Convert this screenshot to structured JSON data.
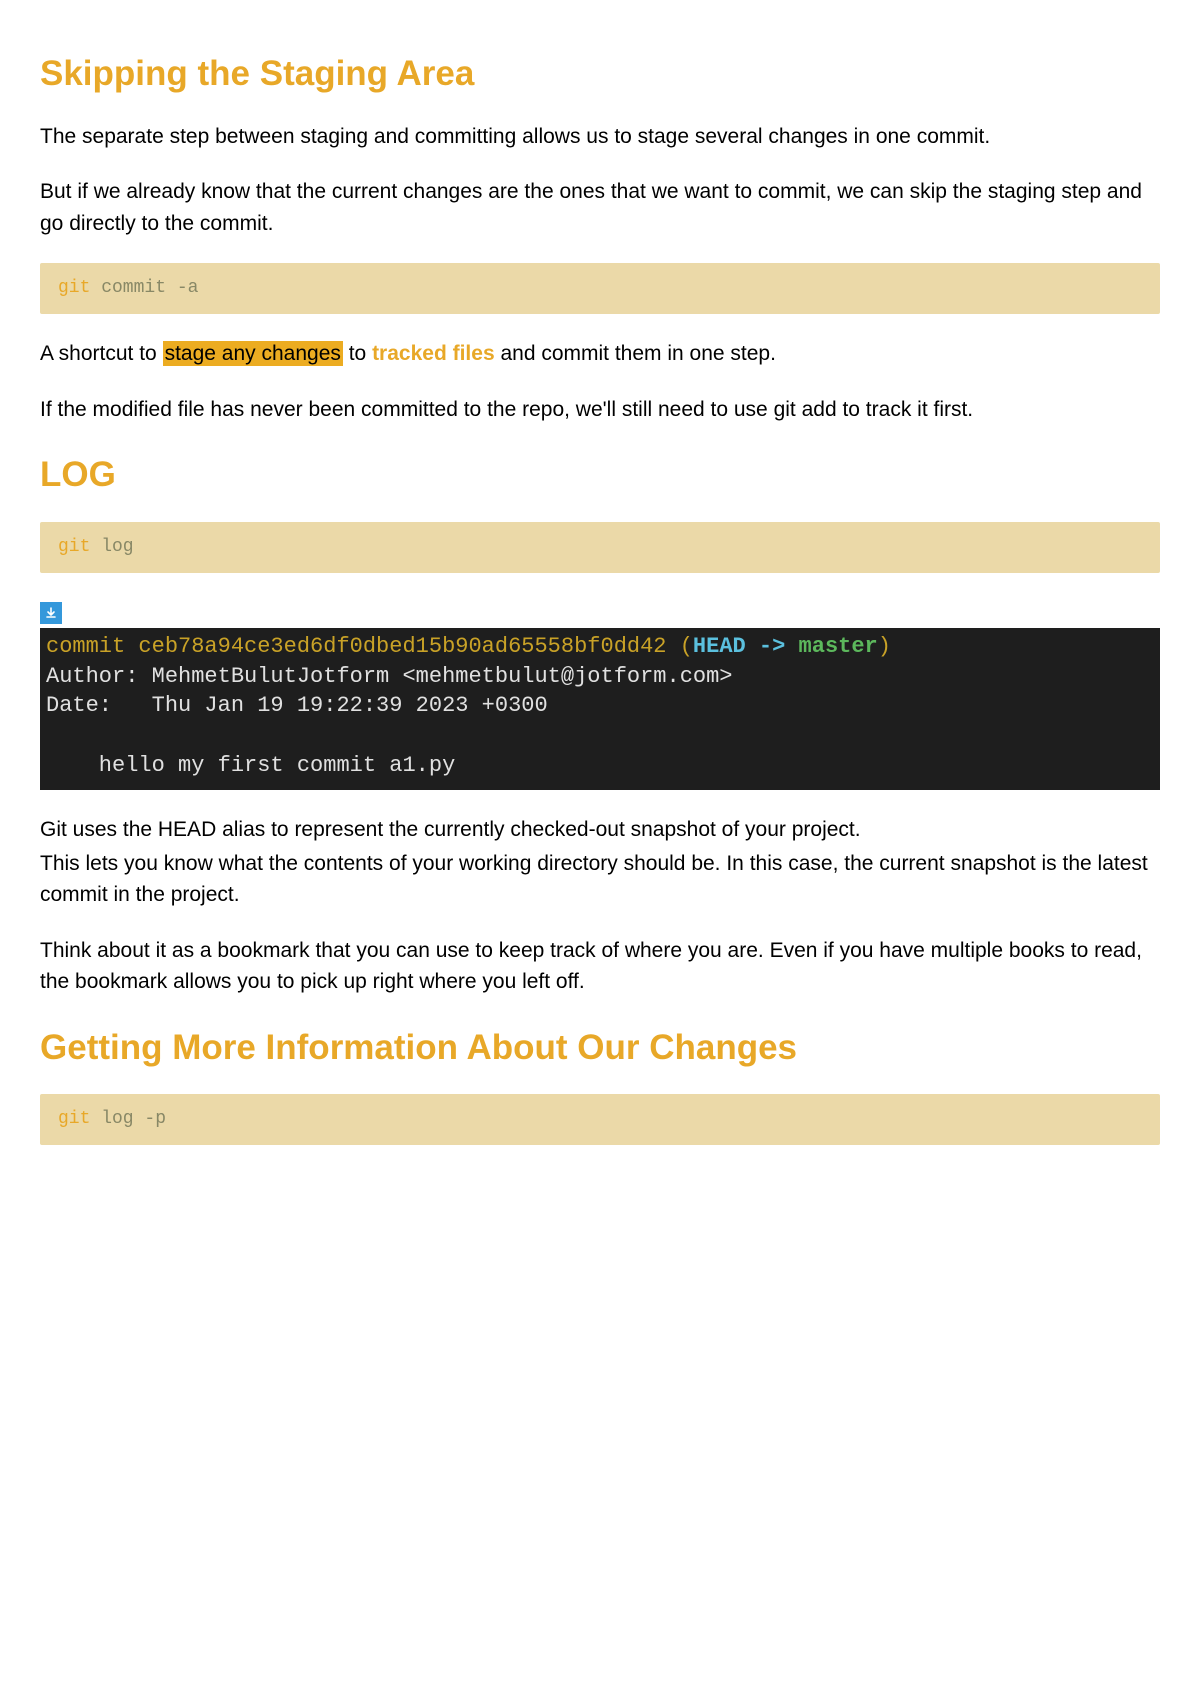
{
  "section1": {
    "heading": "Skipping the Staging Area",
    "p1": "The separate step between staging and committing allows us to stage several changes in one commit.",
    "p2": "But if we already know that the current changes are the ones that we want to commit, we can skip the staging step and go directly to the commit.",
    "code1_git": "git",
    "code1_rest": " commit -a",
    "p3_a": "A shortcut to ",
    "p3_highlight": "stage any changes",
    "p3_b": " to ",
    "p3_bold": "tracked files",
    "p3_c": " and commit them in one step.",
    "p4": "If the modified file has never been committed to the repo, we'll still need to use git add to track it first."
  },
  "section2": {
    "heading": "LOG",
    "code1_git": "git",
    "code1_rest": " log",
    "terminal": {
      "l1_a": "commit ceb78a94ce3ed6df0dbed15b90ad65558bf0dd42",
      "l1_paren_open": " (",
      "l1_head": "HEAD -> ",
      "l1_master": "master",
      "l1_paren_close": ")",
      "l2": "Author: MehmetBulutJotform <mehmetbulut@jotform.com>",
      "l3": "Date:   Thu Jan 19 19:22:39 2023 +0300",
      "l4": "",
      "l5": "    hello my first commit a1.py"
    },
    "p1a": "Git uses the HEAD alias to represent the currently checked-out snapshot of your project.",
    "p1b": "This lets you know what the contents of your working directory should be. In this case, the current snapshot is the latest commit in the project.",
    "p2": "Think about it as a bookmark that you can use to keep track of where you are. Even if you have multiple books to read, the bookmark allows you to pick up right where you left off."
  },
  "section3": {
    "heading": "Getting More Information About Our Changes",
    "code1_git": "git",
    "code1_rest": " log -p"
  },
  "icons": {
    "download_arrow": "↓"
  }
}
